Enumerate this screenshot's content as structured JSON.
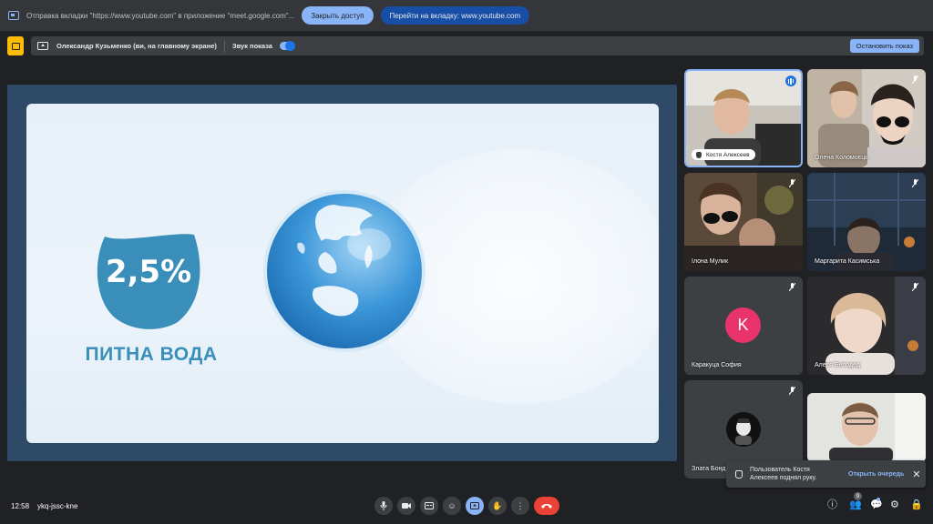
{
  "share_bar": {
    "message": "Отправка вкладки \"https://www.youtube.com\" в приложение \"meet.google.com\"...",
    "stop_access_label": "Закрыть доступ",
    "goto_tab_label": "Перейти на вкладку: www.youtube.com"
  },
  "present_bar": {
    "presenter": "Олександр Кузьменко (ви, на главному экране)",
    "sound_label": "Звук показа",
    "sound_on": true,
    "stop_show_label": "Остановить показ"
  },
  "slide": {
    "percent": "2,5%",
    "caption": "ПИТНА ВОДА"
  },
  "participants": [
    {
      "name": "Костя Алексеев",
      "raised_hand": true,
      "speaking": true
    },
    {
      "name": "Олена Коломоєць"
    },
    {
      "name": "Ілона Мулик"
    },
    {
      "name": "Маргарита Касимська"
    },
    {
      "name": "Каракуца София",
      "avatar_letter": "K"
    },
    {
      "name": "Алеся Белодед"
    },
    {
      "name": "Злата Бонд"
    },
    {
      "name": ""
    }
  ],
  "toast": {
    "text": "Пользователь Костя Алексеев поднял руку.",
    "action": "Открыть очередь"
  },
  "bottom": {
    "time": "12:58",
    "meeting_code": "ykq-jssc-kne",
    "participant_count": "9"
  },
  "colors": {
    "accent": "#8ab4f8",
    "end_call": "#ea4335",
    "slide_teal": "#3a8fba",
    "avatar_pink": "#e8336c"
  }
}
